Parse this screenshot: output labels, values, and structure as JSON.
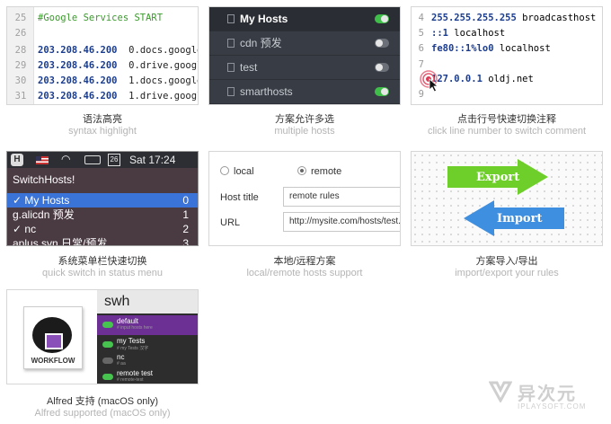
{
  "features": [
    {
      "caption": "语法高亮",
      "sub": "syntax highlight"
    },
    {
      "caption": "方案允许多选",
      "sub": "multiple hosts"
    },
    {
      "caption": "点击行号快速切换注释",
      "sub": "click line number to switch comment"
    },
    {
      "caption": "系统菜单栏快速切换",
      "sub": "quick switch in status menu"
    },
    {
      "caption": "本地/远程方案",
      "sub": "local/remote hosts support"
    },
    {
      "caption": "方案导入/导出",
      "sub": "import/export your rules"
    },
    {
      "caption": "Alfred 支持 (macOS only)",
      "sub": "Alfred supported (macOS only)"
    }
  ],
  "syntax": {
    "lines": [
      {
        "n": "25",
        "ip": "",
        "host": "#Google Services START",
        "comment": true
      },
      {
        "n": "26",
        "ip": "",
        "host": "",
        "comment": false
      },
      {
        "n": "28",
        "ip": "203.208.46.200",
        "host": "0.docs.google.",
        "comment": false
      },
      {
        "n": "29",
        "ip": "203.208.46.200",
        "host": "0.drive.google",
        "comment": false
      },
      {
        "n": "30",
        "ip": "203.208.46.200",
        "host": "1.docs.google.",
        "comment": false
      },
      {
        "n": "31",
        "ip": "203.208.46.200",
        "host": "1.drive.google",
        "comment": false
      }
    ]
  },
  "multi": {
    "items": [
      {
        "label": "My Hosts",
        "on": true
      },
      {
        "label": "cdn 预发",
        "on": false
      },
      {
        "label": "test",
        "on": false
      },
      {
        "label": "smarthosts",
        "on": true
      }
    ]
  },
  "clicklines": {
    "lines": [
      {
        "n": "4",
        "ip": "255.255.255.255",
        "host": "broadcasthost"
      },
      {
        "n": "5",
        "ip": "::1",
        "host": "localhost"
      },
      {
        "n": "6",
        "ip": "fe80::1%lo0",
        "host": "localhost"
      },
      {
        "n": "7",
        "ip": "",
        "host": ""
      },
      {
        "n": "8",
        "ip": "127.0.0.1",
        "host": "oldj.net"
      },
      {
        "n": "9",
        "ip": "",
        "host": ""
      }
    ]
  },
  "status": {
    "menubar": {
      "app_letter": "H",
      "badge": "26",
      "time": "Sat 17:24"
    },
    "title": "SwitchHosts!",
    "items": [
      {
        "label": "✓ My Hosts",
        "num": "0",
        "selected": true
      },
      {
        "label": "g.alicdn 预发",
        "num": "1",
        "selected": false
      },
      {
        "label": "✓ nc",
        "num": "2",
        "selected": false
      },
      {
        "label": "aplus.svn 日常/预发",
        "num": "3",
        "selected": false
      }
    ]
  },
  "remote": {
    "local_label": "local",
    "remote_label": "remote",
    "host_title_label": "Host title",
    "host_title_value": "remote rules",
    "url_label": "URL",
    "url_value": "http://mysite.com/hosts/test.txt"
  },
  "impexp": {
    "export": "Export",
    "import": "Import",
    "export_color": "#6fcf2a",
    "import_color": "#3f8fe0"
  },
  "alfred": {
    "workflow_label": "WORKFLOW",
    "query": "swh",
    "items": [
      {
        "title": "default",
        "sub": "# input hosts here",
        "on": true,
        "selected": true
      },
      {
        "title": "my Tests",
        "sub": "# my Tests 汉字",
        "on": true,
        "selected": false
      },
      {
        "title": "nc",
        "sub": "# aa",
        "on": false,
        "selected": false
      },
      {
        "title": "remote test",
        "sub": "# remote-test",
        "on": true,
        "selected": false
      }
    ]
  },
  "watermark": {
    "brand": "异次元",
    "site": "IPLAYSOFT.COM"
  }
}
